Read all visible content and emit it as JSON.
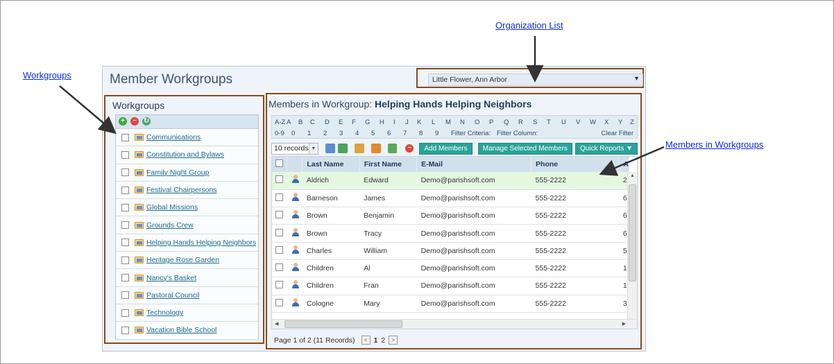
{
  "callouts": {
    "org_list": "Organization List",
    "workgroups": "Workgroups",
    "members_in_workgroups": "Members in Workgroups"
  },
  "header": {
    "title": "Member Workgroups",
    "org_selected": "Little Flower, Ann Arbor"
  },
  "workgroups": {
    "title": "Workgroups",
    "items": [
      "Communications",
      "Constitution and Bylaws",
      "Family Night Group",
      "Festival Chairpersons",
      "Global Missions",
      "Grounds Crew",
      "Helping Hands Helping Neighbors",
      "Heritage Rose Garden",
      "Nancy's Basket",
      "Pastoral Council",
      "Technology",
      "Vacation Bible School"
    ]
  },
  "members": {
    "title_prefix": "Members in Workgroup:",
    "title_group": "Helping Hands Helping Neighbors",
    "alpha_row1": [
      "A-Z",
      "A",
      "B",
      "C",
      "D",
      "E",
      "F",
      "G",
      "H",
      "I",
      "J",
      "K",
      "L",
      "M",
      "N",
      "O",
      "P",
      "Q",
      "R",
      "S",
      "T",
      "U",
      "V",
      "W",
      "X",
      "Y",
      "Z"
    ],
    "alpha_row2": [
      "0-9",
      "0",
      "1",
      "2",
      "3",
      "4",
      "5",
      "6",
      "7",
      "8",
      "9"
    ],
    "filter_criteria": "Filter Criteria:",
    "filter_column": "Filter Column:",
    "clear_filter": "Clear Filter",
    "records_select": "10 records",
    "add_members": "Add Members",
    "manage_selected": "Manage Selected Members",
    "quick_reports": "Quick Reports ▼",
    "columns": [
      "Last Name",
      "First Name",
      "E-Mail",
      "Phone",
      "A"
    ],
    "rows": [
      {
        "last": "Aldrich",
        "first": "Edward",
        "email": "Demo@parishsoft.com",
        "phone": "555-2222",
        "a": "2"
      },
      {
        "last": "Barneson",
        "first": "James",
        "email": "Demo@parishsoft.com",
        "phone": "555-2222",
        "a": "6"
      },
      {
        "last": "Brown",
        "first": "Benjamin",
        "email": "Demo@parishsoft.com",
        "phone": "555-2222",
        "a": "6"
      },
      {
        "last": "Brown",
        "first": "Tracy",
        "email": "Demo@parishsoft.com",
        "phone": "555-2222",
        "a": "6"
      },
      {
        "last": "Charles",
        "first": "William",
        "email": "Demo@parishsoft.com",
        "phone": "555-2222",
        "a": "5"
      },
      {
        "last": "Children",
        "first": "Al",
        "email": "Demo@parishsoft.com",
        "phone": "555-2222",
        "a": "1"
      },
      {
        "last": "Children",
        "first": "Fran",
        "email": "Demo@parishsoft.com",
        "phone": "555-2222",
        "a": "1"
      },
      {
        "last": "Cologne",
        "first": "Mary",
        "email": "Demo@parishsoft.com",
        "phone": "555-2222",
        "a": "3"
      }
    ],
    "pager_text": "Page 1 of 2 (11 Records)",
    "pages": [
      "1",
      "2"
    ]
  }
}
